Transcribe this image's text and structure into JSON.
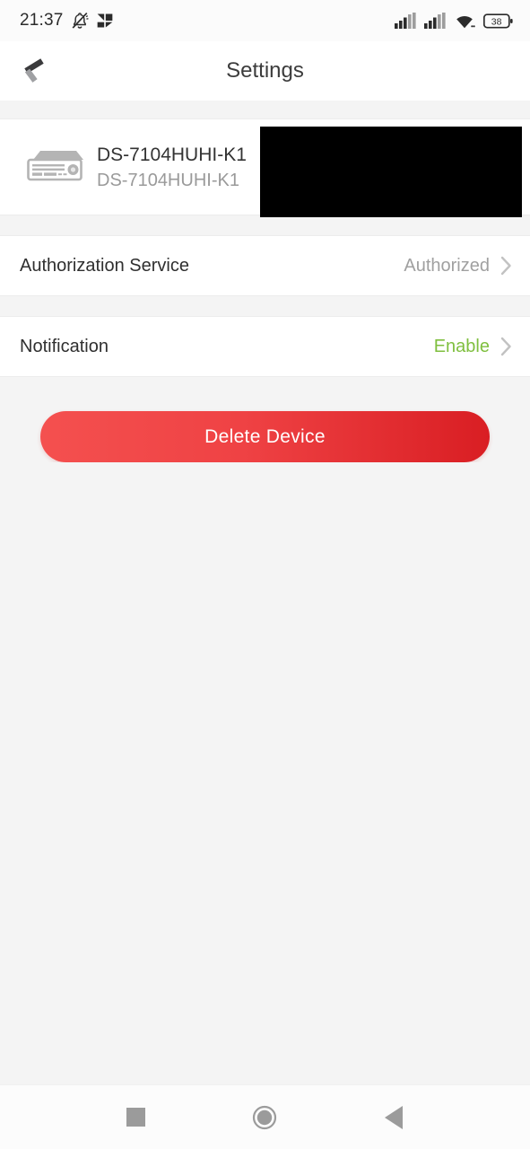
{
  "statusbar": {
    "time": "21:37",
    "icons_left": [
      "bell-muted-icon",
      "data-saver-off-icon"
    ],
    "icons_right": [
      "signal-bars-sim1-icon",
      "signal-bars-sim2-icon",
      "wifi-icon",
      "battery-icon"
    ],
    "battery_level": "38"
  },
  "titlebar": {
    "title": "Settings",
    "back_icon": "back-chevron-icon"
  },
  "device": {
    "icon": "dvr-device-icon",
    "name": "DS-7104HUHI-K1",
    "subtitle": "DS-7104HUHI-K1",
    "redacted": true
  },
  "settings": {
    "rows": [
      {
        "label": "Authorization Service",
        "value": "Authorized",
        "value_style": "gray",
        "chevron": "chevron-right-icon"
      },
      {
        "label": "Notification",
        "value": "Enable",
        "value_style": "green",
        "chevron": "chevron-right-icon"
      }
    ]
  },
  "actions": {
    "delete_label": "Delete Device"
  },
  "navbar": {
    "recents_icon": "square-recents-icon",
    "home_icon": "circle-home-icon",
    "back_icon": "triangle-back-icon"
  },
  "colors": {
    "accent_green": "#7fbf3f",
    "danger_red_light": "#f4504f",
    "danger_red_dark": "#d91e23",
    "page_bg": "#f4f4f4",
    "card_bg": "#ffffff",
    "text_primary": "#333333",
    "text_secondary": "#9a9a9a"
  }
}
